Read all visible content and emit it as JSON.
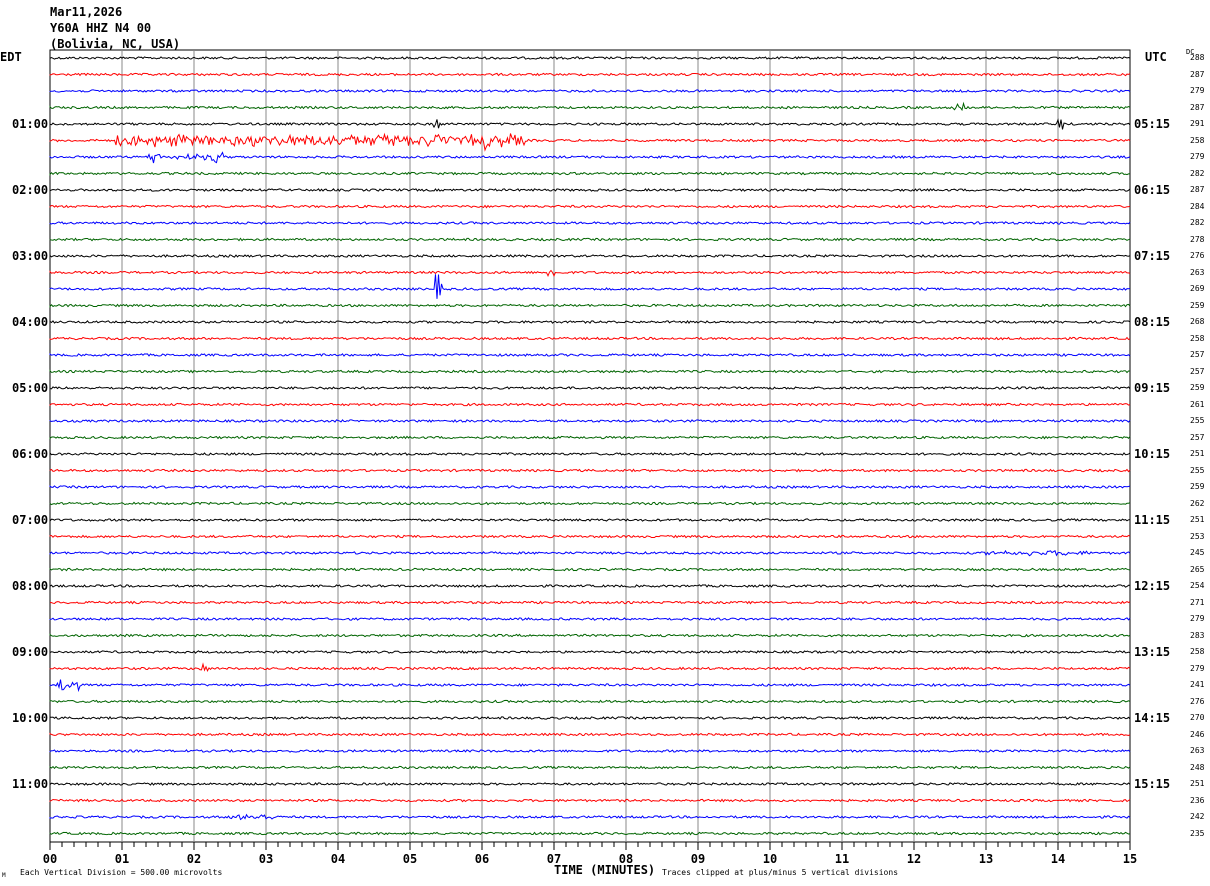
{
  "header": {
    "date": "Mar11,2026",
    "station": "Y60A HHZ N4 00",
    "location": "(Bolivia, NC, USA)"
  },
  "left_timezone": "EDT",
  "right_timezone": "UTC",
  "dc_header": "DC",
  "footer": {
    "scale_note": "Each Vertical Division =  500.00 microvolts",
    "xlabel": "TIME (MINUTES)",
    "clip_note": "Traces clipped at plus/minus 5 vertical divisions",
    "corner_mark": "M"
  },
  "chart_data": {
    "type": "line",
    "xlabel": "TIME (MINUTES)",
    "xlim": [
      0,
      15
    ],
    "x_tick_labels": [
      "00",
      "01",
      "02",
      "03",
      "04",
      "05",
      "06",
      "07",
      "08",
      "09",
      "10",
      "11",
      "12",
      "13",
      "14",
      "15"
    ],
    "grid": true,
    "left_hour_labels": [
      "01:00",
      "02:00",
      "03:00",
      "04:00",
      "05:00",
      "06:00",
      "07:00",
      "08:00",
      "09:00",
      "10:00",
      "11:00"
    ],
    "right_hour_labels": [
      "05:15",
      "06:15",
      "07:15",
      "08:15",
      "09:15",
      "10:15",
      "11:15",
      "12:15",
      "13:15",
      "14:15",
      "15:15"
    ],
    "trace_colors": [
      "#000000",
      "#ff0000",
      "#0000ff",
      "#006400"
    ],
    "dc_offsets": [
      288,
      287,
      279,
      287,
      291,
      258,
      279,
      282,
      287,
      284,
      282,
      278,
      276,
      263,
      269,
      259,
      268,
      258,
      257,
      257,
      259,
      261,
      255,
      257,
      251,
      255,
      259,
      262,
      251,
      253,
      245,
      265,
      254,
      271,
      279,
      283,
      258,
      279,
      241,
      276,
      270,
      246,
      263,
      248,
      251,
      236,
      242,
      235
    ]
  }
}
